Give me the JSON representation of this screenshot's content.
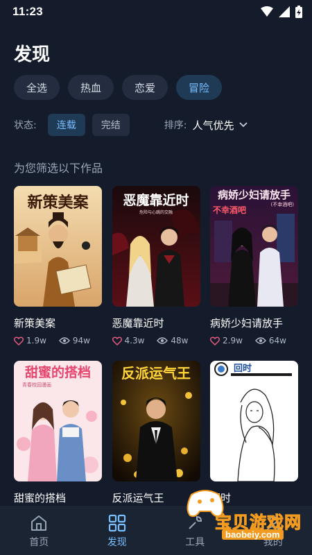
{
  "status_bar": {
    "time": "11:23"
  },
  "header": {
    "title": "发现"
  },
  "genres": [
    {
      "label": "全选",
      "active": false
    },
    {
      "label": "热血",
      "active": false
    },
    {
      "label": "恋爱",
      "active": false
    },
    {
      "label": "冒险",
      "active": true
    }
  ],
  "filters": {
    "status_label": "状态:",
    "status_options": [
      "连载",
      "完结"
    ],
    "status_selected": "连载",
    "sort_label": "排序:",
    "sort_value": "人气优先"
  },
  "section_hint": "为您筛选以下作品",
  "works": [
    {
      "title": "新策美案",
      "cover_text": "新策美案",
      "likes": "1.9w",
      "views": "94w"
    },
    {
      "title": "恶魔靠近时",
      "cover_text": "恶魔靠近时",
      "cover_subtext": "危险与心跳的交融",
      "likes": "4.3w",
      "views": "48w"
    },
    {
      "title": "病娇少妇请放手",
      "cover_text": "病娇少妇请放手",
      "cover_subtext": "(不幸酒吧)",
      "cover_sign": "不幸酒吧",
      "likes": "2.9w",
      "views": "64w"
    },
    {
      "title": "甜蜜的搭档",
      "cover_text": "甜蜜的搭档",
      "cover_subtext": "青春校园漫画"
    },
    {
      "title": "反派运气王",
      "cover_text": "反派运气王"
    },
    {
      "title": "回时",
      "cover_text": "回时"
    }
  ],
  "nav": [
    {
      "label": "首页",
      "active": false
    },
    {
      "label": "发现",
      "active": true
    },
    {
      "label": "工具",
      "active": false
    },
    {
      "label": "我的",
      "active": false
    }
  ],
  "watermark": {
    "text": "宝贝游戏网",
    "url": "baobeiy.com"
  },
  "colors": {
    "background": "#141c2b",
    "accent": "#79bfff",
    "chip": "#232d3f",
    "chip_active": "#1f3a55"
  }
}
